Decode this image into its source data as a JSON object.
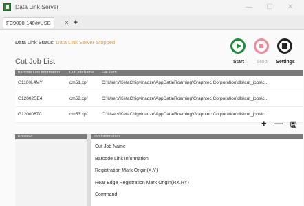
{
  "window": {
    "title": "Data Link Server",
    "minimize_glyph": "—",
    "maximize_glyph": "☐",
    "close_glyph": "✕"
  },
  "tab": {
    "label": "FC9000-140@USB",
    "close_glyph": "×",
    "add_glyph": "+"
  },
  "status": {
    "label": "Data Link Status:",
    "value": "Data Link Server Stopped",
    "value_color": "#f0a020"
  },
  "controls": {
    "start_label": "Start",
    "stop_label": "Stop",
    "settings_label": "Settings",
    "start_icon": "play-circle-icon",
    "stop_icon": "stop-circle-icon",
    "settings_icon": "menu-circle-icon"
  },
  "cut_job_list": {
    "title": "Cut Job List",
    "columns": [
      "Barcode Link Information",
      "Cut Job Name",
      "File Path"
    ],
    "rows": [
      [
        "G1100L4MY",
        "cm51.xpf",
        "C:\\Users\\KetaChigvinadze\\AppData\\Roaming\\Graphtec Corporation\\dls\\cut_jobs\\c..."
      ],
      [
        "G12002SE4",
        "cm52.xpf",
        "C:\\Users\\KetaChigvinadze\\AppData\\Roaming\\Graphtec Corporation\\dls\\cut_jobs\\c..."
      ],
      [
        "G1200087C",
        "cm53.xpf",
        "C:\\Users\\KetaChigvinadze\\AppData\\Roaming\\Graphtec Corporation\\dls\\cut_jobs\\c..."
      ]
    ]
  },
  "toolbar": {
    "add_glyph": "+",
    "remove_glyph": "—",
    "save_glyph": "🖫"
  },
  "preview": {
    "header": "Preview"
  },
  "job_information": {
    "header": "Job Information",
    "items": [
      "Cut Job Name",
      "Barcode Link Information",
      "Registration Mark Origin(X,Y)",
      "Rear Edge Registration Mark Origin(RX,RY)",
      "Command"
    ]
  }
}
